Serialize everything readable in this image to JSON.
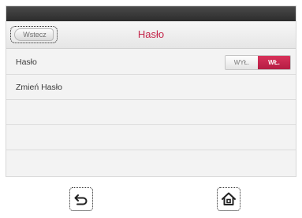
{
  "header": {
    "back_label": "Wstecz",
    "title": "Hasło"
  },
  "rows": [
    {
      "label": "Hasło",
      "toggle": {
        "off_label": "WYŁ.",
        "on_label": "WŁ.",
        "selected": "on"
      }
    },
    {
      "label": "Zmień Hasło"
    }
  ],
  "nav": {
    "back_icon": "return-arrow-icon",
    "home_icon": "home-icon"
  },
  "colors": {
    "accent": "#c4254a",
    "toggle_on": "#c8284f"
  }
}
